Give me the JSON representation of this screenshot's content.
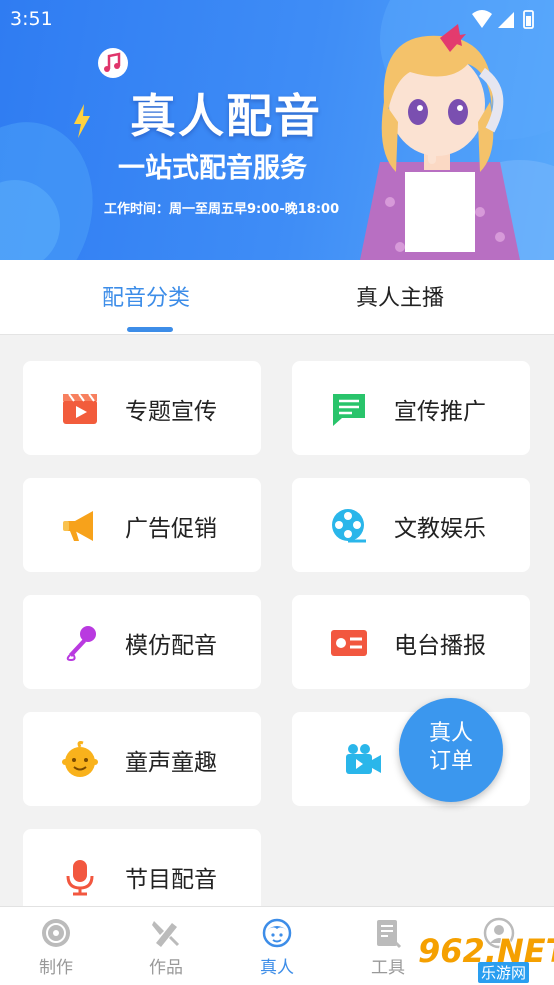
{
  "status_bar": {
    "time": "3:51"
  },
  "banner": {
    "title": "真人配音",
    "subtitle": "一站式配音服务",
    "work_time": "工作时间：周一至周五早9:00-晚18:00"
  },
  "tabs": [
    {
      "label": "配音分类",
      "active": true
    },
    {
      "label": "真人主播",
      "active": false
    }
  ],
  "categories": [
    {
      "label": "专题宣传",
      "icon": "video-clapper-icon",
      "color": "#f25c3c"
    },
    {
      "label": "宣传推广",
      "icon": "message-icon",
      "color": "#29c46b"
    },
    {
      "label": "广告促销",
      "icon": "megaphone-icon",
      "color": "#f7a21b"
    },
    {
      "label": "文教娱乐",
      "icon": "film-reel-icon",
      "color": "#2ab6ea"
    },
    {
      "label": "模仿配音",
      "icon": "microphone-icon",
      "color": "#b93ae0"
    },
    {
      "label": "电台播报",
      "icon": "radio-card-icon",
      "color": "#f2573f"
    },
    {
      "label": "童声童趣",
      "icon": "child-face-icon",
      "color": "#f9b21c"
    },
    {
      "label": "",
      "icon": "video-camera-icon",
      "color": "#2ab6ea"
    },
    {
      "label": "节目配音",
      "icon": "program-mic-icon",
      "color": "#f2573f"
    }
  ],
  "fab": {
    "line1": "真人",
    "line2": "订单"
  },
  "bottom_nav": [
    {
      "label": "制作",
      "icon": "disc-icon",
      "active": false
    },
    {
      "label": "作品",
      "icon": "works-icon",
      "active": false
    },
    {
      "label": "真人",
      "icon": "person-icon",
      "active": true
    },
    {
      "label": "工具",
      "icon": "tools-icon",
      "active": false
    },
    {
      "label": "",
      "icon": "profile-icon",
      "active": false
    }
  ],
  "watermark": {
    "brand": "962.NET",
    "sub": "乐游网"
  },
  "colors": {
    "accent": "#3d8de8",
    "banner": "#3f8df6",
    "fab": "#3b97ee"
  }
}
